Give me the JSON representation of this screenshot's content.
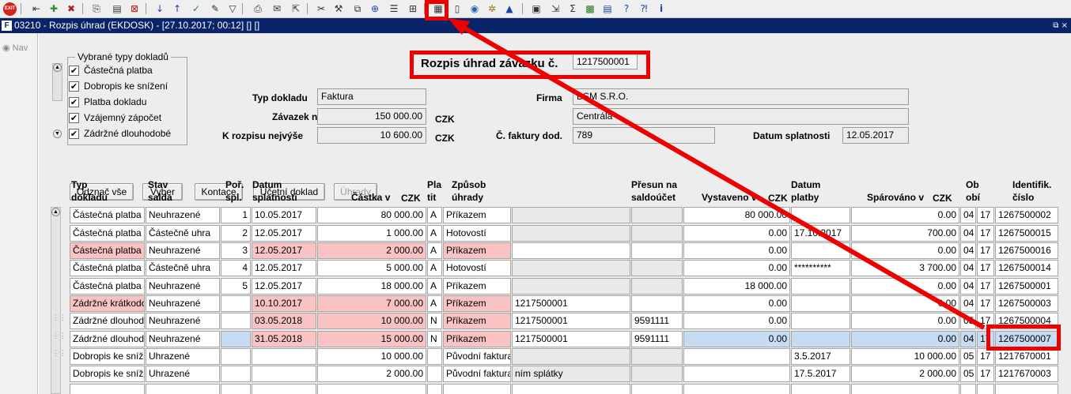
{
  "window": {
    "title": "03210 - Rozpis úhrad (EKDOSK) - [27.10.2017; 00:12] [] []",
    "controls": "⧉ ×"
  },
  "toolbar": {
    "exit_label": "EXIT",
    "icons": [
      "first-record-icon",
      "prev-record-icon",
      "delete-record-icon",
      "copy-icon",
      "paste-icon",
      "clear-icon",
      "sort-asc-icon",
      "sort-desc-icon",
      "check-icon",
      "edit-icon",
      "filter-icon",
      "print-icon",
      "send-icon",
      "open-icon",
      "cut-icon",
      "tools-icon",
      "zoom-icon",
      "list-icon",
      "tree-icon",
      "report-icon",
      "document-icon",
      "globe-icon",
      "settings-icon",
      "mountain-icon",
      "calendar-icon",
      "export-icon",
      "sum-icon",
      "excel-icon",
      "calculator-icon",
      "help-icon",
      "context-help-icon",
      "info-icon"
    ]
  },
  "nav": {
    "label": "Nav"
  },
  "doc_types": {
    "legend": "Vybrané typy dokladů",
    "items": [
      {
        "label": "Částečná platba",
        "checked": true
      },
      {
        "label": "Dobropis ke snížení",
        "checked": true
      },
      {
        "label": "Platba dokladu",
        "checked": true
      },
      {
        "label": "Vzájemný zápočet",
        "checked": true
      },
      {
        "label": "Zádržné dlouhodobé",
        "checked": true
      }
    ]
  },
  "header": {
    "title_label": "Rozpis úhrad závazku č.",
    "title_value": "1217500001",
    "typ_dokladu_label": "Typ dokladu",
    "typ_dokladu_value": "Faktura",
    "zavazek_label": "Závazek na",
    "zavazek_value": "150 000.00",
    "zavazek_currency": "CZK",
    "k_rozpisu_label": "K rozpisu nejvýše",
    "k_rozpisu_value": "10 600.00",
    "k_rozpisu_currency": "CZK",
    "firma_label": "Firma",
    "firma_value": "BSM S.R.O.",
    "firma_branch": "Centrála",
    "cislo_faktury_label": "Č. faktury dod.",
    "cislo_faktury_value": "789",
    "datum_splatnosti_label": "Datum splatnosti",
    "datum_splatnosti_value": "12.05.2017"
  },
  "buttons": {
    "odznac": "Odznač vše",
    "vyber": "Vyber",
    "kontace": "Kontace",
    "ucetni": "Účetní doklad",
    "uhrady": "Úhrady"
  },
  "table": {
    "headers": {
      "typ": "Typ\ndokladu",
      "stav": "Stav\nsalda",
      "por": "Poř.\nspl.",
      "datum": "Datum\nsplatnosti",
      "castka": "Částka v",
      "castka_cur": "CZK",
      "plat": "Pla\ntit",
      "zpusob": "Způsob\núhrady",
      "presun": "Přesun na\nsaldoúčet",
      "vystaveno": "Vystaveno v",
      "vystaveno_cur": "CZK",
      "datum_platby": "Datum\nplatby",
      "sparovano": "Spárováno v",
      "sparovano_cur": "CZK",
      "obdobi": "Ob\nobí",
      "ident": "Identifik.\nčíslo"
    },
    "rows": [
      {
        "typ": "Částečná platba",
        "stav": "Neuhrazené",
        "por": "1",
        "datum": "10.05.2017",
        "castka": "80 000.00",
        "plat": "A",
        "zpusob": "Příkazem",
        "ref": "",
        "presun": "",
        "vystaveno": "80 000.00",
        "datum_platby": "",
        "sparovano": "0.00",
        "ob1": "04",
        "ob2": "17",
        "ident": "1267500002"
      },
      {
        "typ": "Částečná platba",
        "stav": "Částečně uhra",
        "por": "2",
        "datum": "12.05.2017",
        "castka": "1 000.00",
        "plat": "A",
        "zpusob": "Hotovostí",
        "ref": "",
        "presun": "",
        "vystaveno": "0.00",
        "datum_platby": "17.10.2017",
        "sparovano": "700.00",
        "ob1": "04",
        "ob2": "17",
        "ident": "1267500015"
      },
      {
        "typ": "Částečná platba",
        "stav": "Neuhrazené",
        "por": "3",
        "datum": "12.05.2017",
        "castka": "2 000.00",
        "plat": "A",
        "zpusob": "Příkazem",
        "ref": "",
        "presun": "",
        "vystaveno": "0.00",
        "datum_platby": "",
        "sparovano": "0.00",
        "ob1": "04",
        "ob2": "17",
        "ident": "1267500016"
      },
      {
        "typ": "Částečná platba",
        "stav": "Částečně uhra",
        "por": "4",
        "datum": "12.05.2017",
        "castka": "5 000.00",
        "plat": "A",
        "zpusob": "Hotovostí",
        "ref": "",
        "presun": "",
        "vystaveno": "0.00",
        "datum_platby": "**********",
        "sparovano": "3 700.00",
        "ob1": "04",
        "ob2": "17",
        "ident": "1267500014"
      },
      {
        "typ": "Částečná platba",
        "stav": "Neuhrazené",
        "por": "5",
        "datum": "12.05.2017",
        "castka": "18 000.00",
        "plat": "A",
        "zpusob": "Příkazem",
        "ref": "",
        "presun": "",
        "vystaveno": "18 000.00",
        "datum_platby": "",
        "sparovano": "0.00",
        "ob1": "04",
        "ob2": "17",
        "ident": "1267500001"
      },
      {
        "typ": "Zádržné krátkodobé",
        "stav": "Neuhrazené",
        "por": "",
        "datum": "10.10.2017",
        "castka": "7 000.00",
        "plat": "A",
        "zpusob": "Příkazem",
        "ref": "1217500001",
        "presun": "",
        "vystaveno": "0.00",
        "datum_platby": "",
        "sparovano": "0.00",
        "ob1": "04",
        "ob2": "17",
        "ident": "1267500003"
      },
      {
        "typ": "Zádržné dlouhodobé",
        "stav": "Neuhrazené",
        "por": "",
        "datum": "03.05.2018",
        "castka": "10 000.00",
        "plat": "N",
        "zpusob": "Příkazem",
        "ref": "1217500001",
        "presun": "9591111",
        "vystaveno": "0.00",
        "datum_platby": "",
        "sparovano": "0.00",
        "ob1": "05",
        "ob2": "17",
        "ident": "1267500004"
      },
      {
        "typ": "Zádržné dlouhodobé",
        "stav": "Neuhrazené",
        "por": "",
        "datum": "31.05.2018",
        "castka": "15 000.00",
        "plat": "N",
        "zpusob": "Příkazem",
        "ref": "1217500001",
        "presun": "9591111",
        "vystaveno": "0.00",
        "datum_platby": "",
        "sparovano": "0.00",
        "ob1": "04",
        "ob2": "17",
        "ident": "1267500007"
      },
      {
        "typ": "Dobropis ke snížení",
        "stav": "Uhrazené",
        "por": "",
        "datum": "",
        "castka": "10 000.00",
        "plat": "",
        "zpusob": "Původní faktura",
        "ref": "",
        "presun": "",
        "vystaveno": "",
        "datum_platby": "3.5.2017",
        "sparovano": "10 000.00",
        "ob1": "05",
        "ob2": "17",
        "ident": "1217670001"
      },
      {
        "typ": "Dobropis ke snížení",
        "stav": "Uhrazené",
        "por": "",
        "datum": "",
        "castka": "2 000.00",
        "plat": "",
        "zpusob": "Původní faktura",
        "ref": "ním splátky",
        "presun": "",
        "vystaveno": "",
        "datum_platby": "17.5.2017",
        "sparovano": "2 000.00",
        "ob1": "05",
        "ob2": "17",
        "ident": "1217670003"
      },
      {
        "typ": "",
        "stav": "",
        "por": "",
        "datum": "",
        "castka": "",
        "plat": "",
        "zpusob": "",
        "ref": "",
        "presun": "",
        "vystaveno": "",
        "datum_platby": "",
        "sparovano": "",
        "ob1": "",
        "ob2": "",
        "ident": ""
      }
    ]
  },
  "colors": {
    "title_bar": "#0a246a",
    "highlight_red": "#ee0000",
    "pink_cell": "#f9c3c3",
    "blue_cell": "#c6dcf3"
  }
}
